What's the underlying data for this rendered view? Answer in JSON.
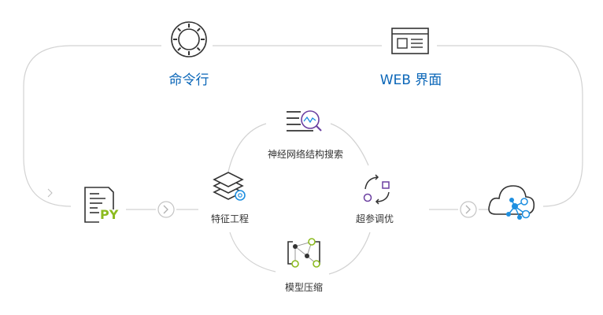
{
  "colors": {
    "accent": "#0a66b8",
    "line": "#d2d2d2",
    "icon": "#333333",
    "purple": "#6b3fa0",
    "green": "#8cbb1f",
    "blue": "#1e8fe0"
  },
  "top": {
    "cli_label": "命令行",
    "web_label": "WEB 界面"
  },
  "stages": {
    "nas": "神经网络结构搜索",
    "feature": "特征工程",
    "hpo": "超参调优",
    "compress": "模型压缩"
  },
  "input": {
    "py_text": "PY"
  },
  "icons": [
    "gear-circle-icon",
    "web-page-icon",
    "python-file-icon",
    "layers-icon",
    "search-chart-icon",
    "cycle-icon",
    "network-compress-icon",
    "cloud-network-icon",
    "chevron-right-icon"
  ]
}
